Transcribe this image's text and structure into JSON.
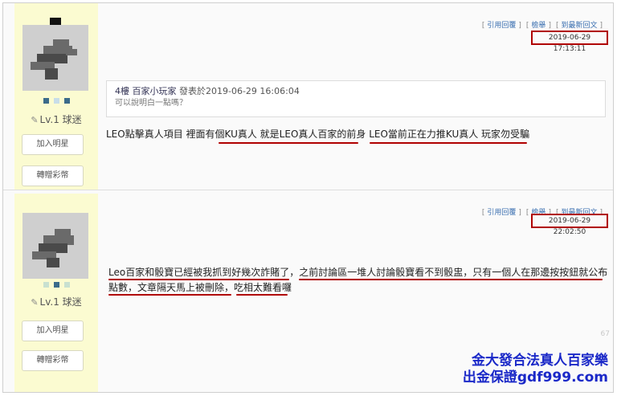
{
  "posts": [
    {
      "links": {
        "quote": "引用回覆",
        "report": "檢舉",
        "latest": "到最新回文"
      },
      "timestamp": "2019-06-29 17:13:11",
      "user": {
        "level": "Lv.1 球迷",
        "add_friend": "加入明星",
        "gift_coins": "轉贈彩幣"
      },
      "quote": {
        "floor": "4樓",
        "author": "百家小玩家",
        "posted_label": "發表於",
        "posted_at": "2019-06-29 16:06:04",
        "text": "可以說明白一點嗎？"
      },
      "body": "LEO點擊真人項目 裡面有個KU真人 就是LEO真人百家的前身 LEO當前正在力推KU真人 玩家勿受騙"
    },
    {
      "links": {
        "quote": "引用回覆",
        "report": "檢舉",
        "latest": "到最新回文"
      },
      "timestamp": "2019-06-29 22:02:50",
      "user": {
        "level": "Lv.1 球迷",
        "add_friend": "加入明星",
        "gift_coins": "轉贈彩幣"
      },
      "body_line1": "Leo百家和骰寶已經被我抓到好幾次詐賭了，之前討論區一堆人討論骰寶看不到骰盅，只有一個人在那邊按按鈕就公布",
      "body_line2": "點數，文章隔天馬上被刪除，吃相太難看囉",
      "counter": "67"
    }
  ],
  "watermark": {
    "line1": "金大發合法真人百家樂",
    "line2": "出金保證gdf999.com"
  },
  "colors": {
    "highlight": "#b00000",
    "sidebar": "#fbfbd1",
    "link": "#3a6fb0",
    "watermark": "#1a28c8"
  },
  "icons": {
    "level": "pencil-icon"
  }
}
